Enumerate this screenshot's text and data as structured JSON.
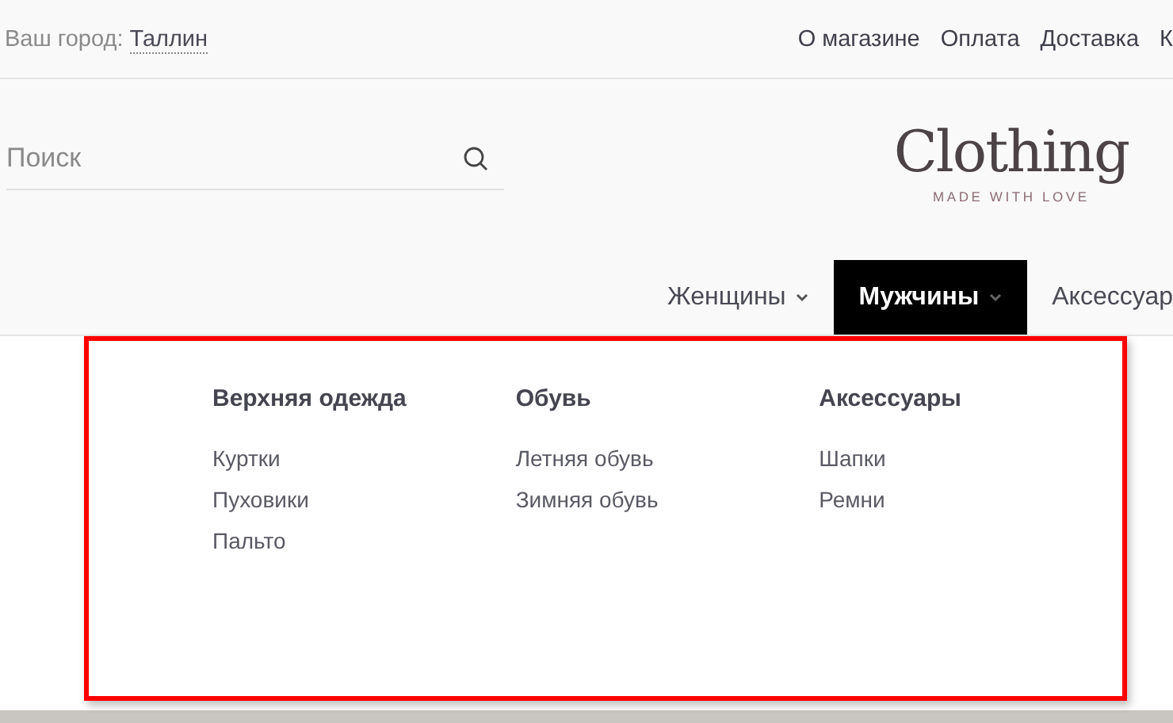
{
  "top_bar": {
    "city_label": "Ваш город:",
    "city": "Таллин",
    "links": [
      "О магазине",
      "Оплата",
      "Доставка",
      "К"
    ]
  },
  "search": {
    "placeholder": "Поиск"
  },
  "logo": {
    "title": "Clothing",
    "tagline": "MADE WITH LOVE"
  },
  "nav": [
    {
      "label": "Женщины",
      "selected": false,
      "has_caret": true
    },
    {
      "label": "Мужчины",
      "selected": true,
      "has_caret": true
    },
    {
      "label": "Аксессуар",
      "selected": false,
      "has_caret": false
    }
  ],
  "mega_menu": {
    "columns": [
      {
        "title": "Верхняя одежда",
        "items": [
          "Куртки",
          "Пуховики",
          "Пальто"
        ]
      },
      {
        "title": "Обувь",
        "items": [
          "Летняя обувь",
          "Зимняя обувь"
        ]
      },
      {
        "title": "Аксессуары",
        "items": [
          "Шапки",
          "Ремни"
        ]
      }
    ]
  }
}
